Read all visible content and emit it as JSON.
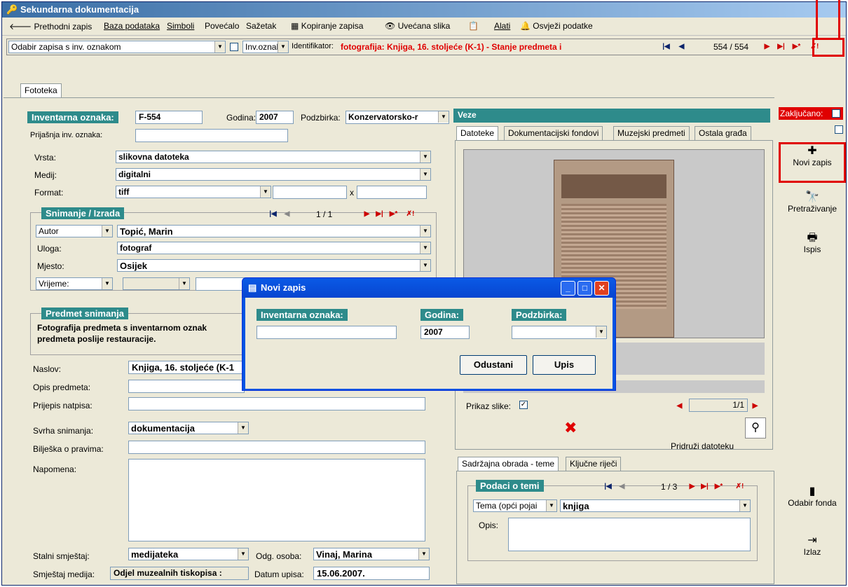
{
  "window": {
    "title": "Sekundarna dokumentacija"
  },
  "toolbar": {
    "prev": "Prethodni zapis",
    "db": "Baza podataka",
    "symbols": "Simboli",
    "enlarge": "Povećalo",
    "summary": "Sažetak",
    "copy": "Kopiranje zapisa",
    "bigimg": "Uvećana slika",
    "tools": "Alati",
    "refresh": "Osvježi podatke"
  },
  "navbar": {
    "select_label": "Odabir zapisa s inv. oznakom",
    "field_select": "Inv.oznaka",
    "identifier_label": "Identifikator:",
    "identifier_value": "fotografija: Knjiga, 16. stoljeće (K-1) - Stanje predmeta i",
    "counter": "554 / 554"
  },
  "tabs": {
    "main": "Fototeka"
  },
  "form": {
    "inv_label": "Inventarna oznaka:",
    "inv_value": "F-554",
    "year_label": "Godina:",
    "year_value": "2007",
    "subcoll_label": "Podzbirka:",
    "subcoll_value": "Konzervatorsko-r",
    "prev_inv_label": "Prijašnja inv. oznaka:",
    "vrsta_label": "Vrsta:",
    "vrsta_value": "slikovna datoteka",
    "medij_label": "Medij:",
    "medij_value": "digitalni",
    "format_label": "Format:",
    "format_value": "tiff",
    "x_sep": "x",
    "snimanje_title": "Snimanje / Izrada",
    "snimanje_counter": "1 / 1",
    "autor_label": "Autor",
    "autor_value": "Topić, Marin",
    "uloga_label": "Uloga:",
    "uloga_value": "fotograf",
    "mjesto_label": "Mjesto:",
    "mjesto_value": "Osijek",
    "vrijeme_label": "Vrijeme:",
    "predmet_title": "Predmet snimanja",
    "predmet_text1": "Fotografija predmeta s inventarnom oznak",
    "predmet_text2": "predmeta poslije restauracije.",
    "naslov_label": "Naslov:",
    "naslov_value": "Knjiga, 16. stoljeće (K-1",
    "opis_label": "Opis predmeta:",
    "prijepis_label": "Prijepis natpisa:",
    "svrha_label": "Svrha snimanja:",
    "svrha_value": "dokumentacija",
    "biljeska_label": "Bilješka o pravima:",
    "napomena_label": "Napomena:",
    "stalni_label": "Stalni smještaj:",
    "stalni_value": "medijateka",
    "odg_label": "Odg. osoba:",
    "odg_value": "Vinaj, Marina",
    "smjestaj_label": "Smještaj medija:",
    "smjestaj_value": "Odjel muzealnih tiskopisa :",
    "datum_label": "Datum upisa:",
    "datum_value": "15.06.2007."
  },
  "veze": {
    "title": "Veze",
    "tabs": [
      "Datoteke",
      "Dokumentacijski fondovi",
      "Muzejski predmeti",
      "Ostala građa"
    ],
    "prikaz_label": "Prikaz slike:",
    "img_counter": "1/1",
    "pridruzi": "Pridruži datoteku"
  },
  "sadrzaj": {
    "tabs": [
      "Sadržajna obrada - teme",
      "Ključne riječi"
    ],
    "group_title": "Podaci o temi",
    "counter": "1 / 3",
    "tema_label": "Tema (opći pojai",
    "tema_value": "knjiga",
    "opis_label": "Opis:"
  },
  "side": {
    "locked_label": "Zaključano:",
    "new": "Novi zapis",
    "search": "Pretraživanje",
    "print": "Ispis",
    "fond": "Odabir fonda",
    "exit": "Izlaz"
  },
  "dialog": {
    "title": "Novi zapis",
    "inv_label": "Inventarna oznaka:",
    "year_label": "Godina:",
    "year_value": "2007",
    "sub_label": "Podzbirka:",
    "cancel": "Odustani",
    "ok": "Upis"
  },
  "colors": {
    "accent": "#2e8b8b",
    "highlight": "#e00000",
    "titlebar": "#3a6ea5"
  }
}
